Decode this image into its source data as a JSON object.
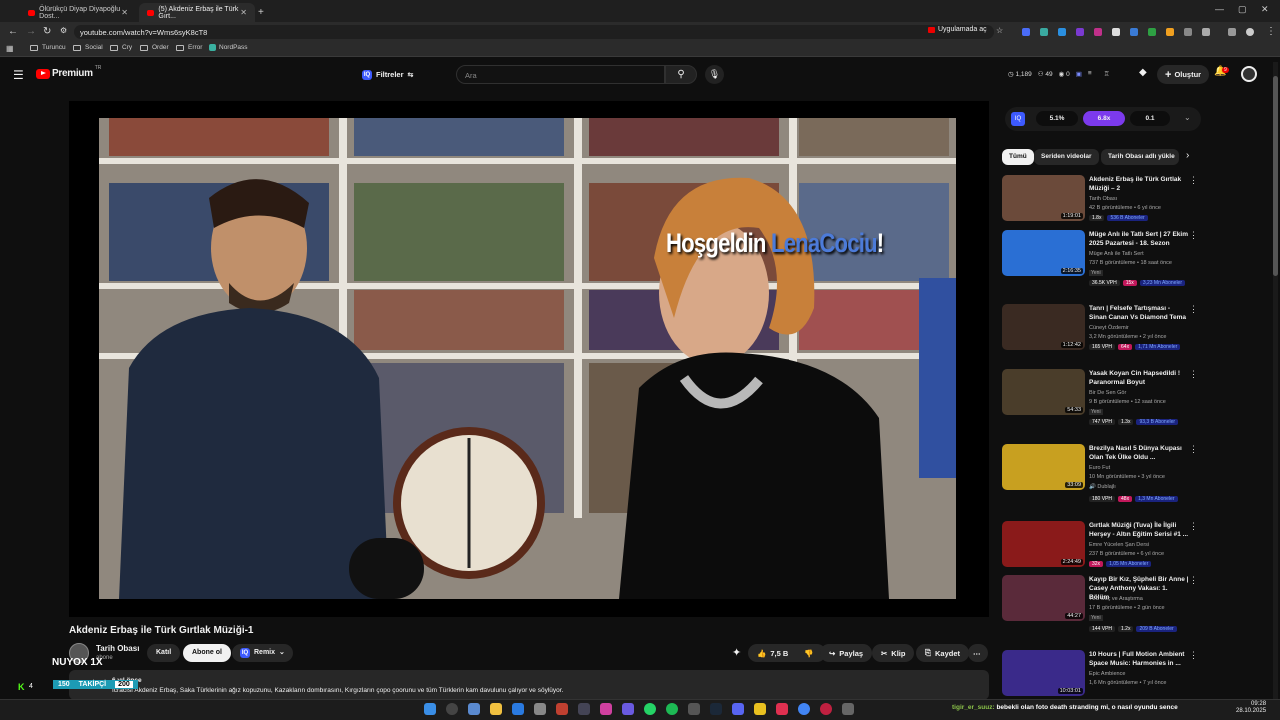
{
  "browser": {
    "tabs": [
      {
        "title": "Ölürükçü Diyap Diyapoğlu Dost..."
      },
      {
        "title": "(5) Akdeniz Erbaş ile Türk Gırt..."
      }
    ],
    "url": "youtube.com/watch?v=Wms6syK8cT8",
    "open_in_app": "Uygulamada aç",
    "bookmarks": [
      "Turuncu",
      "Social",
      "Cry",
      "Order",
      "Error",
      "NordPass"
    ]
  },
  "youtube": {
    "logo": "Premium",
    "logo_region": "TR",
    "filters_label": "Filtreler",
    "search_placeholder": "Ara",
    "stats": {
      "views": "1,189",
      "people": "49",
      "zero": "0"
    },
    "create_label": "Oluştur",
    "notif_count": "9"
  },
  "video": {
    "overlay_welcome": "Hoşgeldin",
    "overlay_name": "LenaCociu",
    "overlay_bang": "!",
    "title": "Akdeniz Erbaş ile Türk Gırtlak Müziği-1",
    "channel": "Tarih Obası",
    "subs": "abone",
    "join": "Katıl",
    "subscribe": "Abone ol",
    "remix": "Remix",
    "likes": "7,5 B",
    "share": "Paylaş",
    "clip": "Klip",
    "save": "Kaydet",
    "desc_meta": "6 yıl önce",
    "desc_text": "İcracısı Akdeniz Erbaş, Saka Türklerinin ağız kopuzunu, Kazakların dombırasını, Kırgızların çopo çoorunu ve tüm Türklerin kam davulunu çalıyor ve söylüyor."
  },
  "stream_overlay": {
    "nuyox": "NUYOX 1X",
    "follow_count": "150",
    "follow_label": "TAKİPÇİ",
    "follow_goal": "200",
    "kick_count": "4"
  },
  "enhancer": {
    "v1": "5.1%",
    "v2": "6.8x",
    "v3": "0.1"
  },
  "chips": [
    "Tümü",
    "Seriden videolar",
    "Tarih Obası adlı yükle"
  ],
  "recommendations": [
    {
      "title": "Akdeniz Erbaş ile Türk Gırtlak Müziği – 2",
      "channel": "Tarih Obası",
      "meta": "42 B görüntüleme • 6 yıl önce",
      "duration": "1:19:01",
      "b1": "1.8x",
      "b3": "536 B Aboneler",
      "thumb": "#6b4a3a"
    },
    {
      "title": "Müge Anlı ile Tatlı Sert | 27 Ekim 2025 Pazartesi - 18. Sezon",
      "channel": "Müge Anlı ile Tatlı Sert",
      "meta": "737 B görüntüleme • 18 saat önce",
      "duration": "2:16:35",
      "new": "Yeni",
      "b1": "36.5K VPH",
      "b2": "15x",
      "b3": "3,23 Mn Aboneler",
      "thumb": "#2a6fd4"
    },
    {
      "title": "Tanrı | Felsefe Tartışması - Sinan Canan Vs Diamond Tema",
      "channel": "Cüneyt Özdemir",
      "meta": "3,2 Mn görüntüleme • 2 yıl önce",
      "duration": "1:12:42",
      "b1": "165 VPH",
      "b2": "64x",
      "b3": "1,71 Mn Aboneler",
      "thumb": "#3a2a22"
    },
    {
      "title": "Yasak Koyan Cin Hapsedildi ! Paranormal Boyut",
      "channel": "Bir De Sen Gör",
      "meta": "9 B görüntüleme • 12 saat önce",
      "duration": "54:33",
      "new": "Yeni",
      "b1": "747 VPH",
      "b2": "1.3x",
      "b3": "93,3 B Aboneler",
      "thumb": "#4a3d2a"
    },
    {
      "title": "Brezilya Nasıl 5 Dünya Kupası Olan Tek Ülke Oldu ...",
      "channel": "Euro Fut",
      "meta": "10 Mn görüntüleme • 3 yıl önce",
      "duration": "33:09",
      "extra": "Dublajlı",
      "b1": "180 VPH",
      "b2": "48x",
      "b3": "1,3 Mn Aboneler",
      "thumb": "#c8a020"
    },
    {
      "title": "Gırtlak Müziği (Tuva) İle İlgili Herşey - Altın Eğitim Serisi #1 ...",
      "channel": "Emre Yücelen Şan Dersi",
      "meta": "237 B görüntüleme • 6 yıl önce",
      "duration": "2:24:49",
      "b2": "32x",
      "b3": "1,05 Mn Aboneler",
      "thumb": "#8a1a1a"
    },
    {
      "title": "Kayıp Bir Kız, Şüpheli Bir Anne | Casey Anthony Vakası: 1. Bölüm",
      "channel": "TLC Suç ve Araştırma",
      "meta": "17 B görüntüleme • 2 gün önce",
      "duration": "44:27",
      "new": "Yeni",
      "b1": "144 VPH",
      "b2": "1.2x",
      "b3": "209 B Aboneler",
      "thumb": "#5a2a3a"
    },
    {
      "title": "10 Hours | Full Motion Ambient Space Music: Harmonies in ...",
      "channel": "Epic Ambience",
      "meta": "1,6 Mn görüntüleme • 7 yıl önce",
      "duration": "10:03:01",
      "thumb": "#3a2a8a"
    }
  ],
  "taskbar": {
    "ticker_user": "tigir_er_suuz:",
    "ticker_text": "bebekli olan foto death stranding mi, o nasıl oyundu sence",
    "time": "09:28",
    "date": "28.10.2025"
  }
}
